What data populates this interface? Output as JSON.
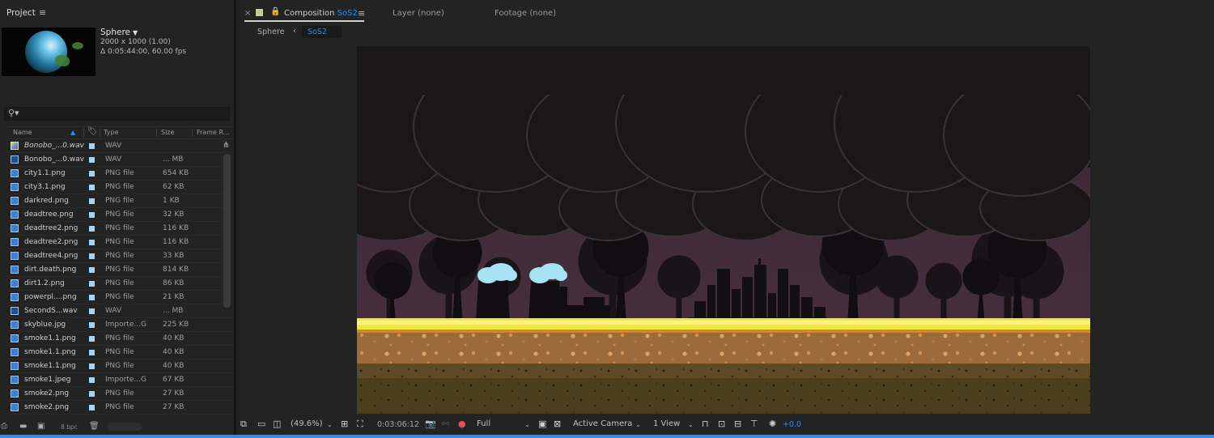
{
  "project": {
    "panel_title": "Project",
    "comp_name": "Sphere",
    "comp_dims": "2000 x 1000 (1.00)",
    "comp_duration": "Δ 0:05:44:00, 60.00 fps",
    "columns": [
      "Name",
      "Type",
      "Size",
      "Frame R..."
    ],
    "items": [
      {
        "name": "Bonobo_...0.wav",
        "type": "WAV",
        "size": "",
        "selected": true
      },
      {
        "name": "Bonobo_...0.wav",
        "type": "WAV",
        "size": "... MB"
      },
      {
        "name": "city1.1.png",
        "type": "PNG file",
        "size": "654 KB"
      },
      {
        "name": "city3.1.png",
        "type": "PNG file",
        "size": "62 KB"
      },
      {
        "name": "darkred.png",
        "type": "PNG file",
        "size": "1 KB"
      },
      {
        "name": "deadtree.png",
        "type": "PNG file",
        "size": "32 KB"
      },
      {
        "name": "deadtree2.png",
        "type": "PNG file",
        "size": "116 KB"
      },
      {
        "name": "deadtree2.png",
        "type": "PNG file",
        "size": "116 KB"
      },
      {
        "name": "deadtree4.png",
        "type": "PNG file",
        "size": "33 KB"
      },
      {
        "name": "dirt.death.png",
        "type": "PNG file",
        "size": "814 KB"
      },
      {
        "name": "dirt1.2.png",
        "type": "PNG file",
        "size": "86 KB"
      },
      {
        "name": "powerpl....png",
        "type": "PNG file",
        "size": "21 KB"
      },
      {
        "name": "SecondS...wav",
        "type": "WAV",
        "size": "... MB"
      },
      {
        "name": "skyblue.jpg",
        "type": "Importe...G",
        "size": "225 KB"
      },
      {
        "name": "smoke1.1.png",
        "type": "PNG file",
        "size": "40 KB"
      },
      {
        "name": "smoke1.1.png",
        "type": "PNG file",
        "size": "40 KB"
      },
      {
        "name": "smoke1.1.png",
        "type": "PNG file",
        "size": "40 KB"
      },
      {
        "name": "smoke1.jpeg",
        "type": "Importe...G",
        "size": "67 KB"
      },
      {
        "name": "smoke2.png",
        "type": "PNG file",
        "size": "27 KB"
      },
      {
        "name": "smoke2.png",
        "type": "PNG file",
        "size": "27 KB"
      }
    ],
    "bpc": "8 bpc"
  },
  "comp_panel": {
    "tab_prefix": "Composition",
    "tab_name": "SoS2",
    "layer_tab": "Layer (none)",
    "footage_tab": "Footage (none)",
    "breadcrumb_parent": "Sphere",
    "breadcrumb_current": "SoS2"
  },
  "viewer_bar": {
    "zoom": "(49.6%)",
    "timecode": "0:03:06:12",
    "resolution": "Full",
    "camera": "Active Camera",
    "views": "1 View",
    "exposure": "+0.0"
  },
  "colors": {
    "accent": "#2d8ceb",
    "sky": "#402c38",
    "smoke": "#1b1618",
    "glow": "#f4e63a",
    "dirt": "#7a5530",
    "steam": "#a7e3f4"
  }
}
